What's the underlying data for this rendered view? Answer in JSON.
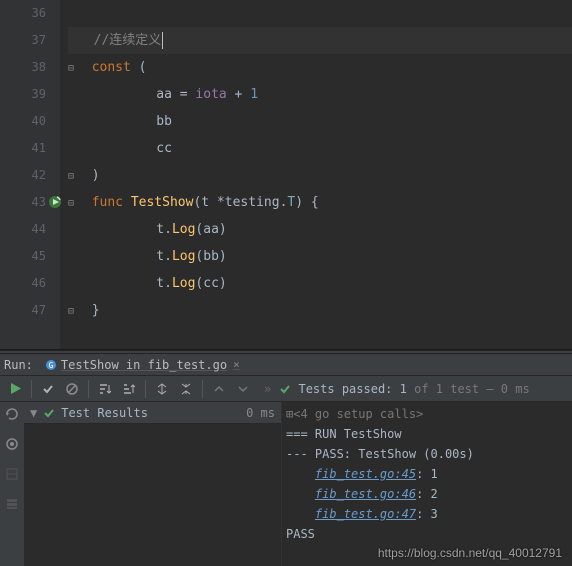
{
  "editor": {
    "lines": [
      {
        "num": 36,
        "tokens": []
      },
      {
        "num": 37,
        "active": true,
        "tokens": [
          {
            "c": "k-comment",
            "t": "//连续定义"
          }
        ],
        "caret": true,
        "indent": 1
      },
      {
        "num": 38,
        "fold": "open",
        "tokens": [
          {
            "c": "k-keyword",
            "t": "const"
          },
          {
            "c": "k-ident",
            "t": " ("
          }
        ],
        "indent": 1
      },
      {
        "num": 39,
        "tokens": [
          {
            "c": "k-ident",
            "t": "aa "
          },
          {
            "c": "k-op",
            "t": "= "
          },
          {
            "c": "k-builtin",
            "t": "iota"
          },
          {
            "c": "k-ident",
            "t": " + "
          },
          {
            "c": "k-num",
            "t": "1"
          }
        ],
        "indent": 3
      },
      {
        "num": 40,
        "tokens": [
          {
            "c": "k-ident",
            "t": "bb"
          }
        ],
        "indent": 3
      },
      {
        "num": 41,
        "tokens": [
          {
            "c": "k-ident",
            "t": "cc"
          }
        ],
        "indent": 3
      },
      {
        "num": 42,
        "fold": "close",
        "tokens": [
          {
            "c": "k-ident",
            "t": ")"
          }
        ],
        "indent": 1
      },
      {
        "num": 43,
        "fold": "open",
        "gutterIcon": true,
        "tokens": [
          {
            "c": "k-keyword",
            "t": "func"
          },
          {
            "c": "k-ident",
            "t": " "
          },
          {
            "c": "k-func",
            "t": "TestShow"
          },
          {
            "c": "k-ident",
            "t": "(t *"
          },
          {
            "c": "k-ident",
            "t": "testing"
          },
          {
            "c": "k-ident",
            "t": "."
          },
          {
            "c": "k-type",
            "t": "T"
          },
          {
            "c": "k-ident",
            "t": ") {"
          }
        ],
        "indent": 1
      },
      {
        "num": 44,
        "tokens": [
          {
            "c": "k-ident",
            "t": "t."
          },
          {
            "c": "k-func",
            "t": "Log"
          },
          {
            "c": "k-ident",
            "t": "(aa)"
          }
        ],
        "indent": 3
      },
      {
        "num": 45,
        "tokens": [
          {
            "c": "k-ident",
            "t": "t."
          },
          {
            "c": "k-func",
            "t": "Log"
          },
          {
            "c": "k-ident",
            "t": "(bb)"
          }
        ],
        "indent": 3
      },
      {
        "num": 46,
        "tokens": [
          {
            "c": "k-ident",
            "t": "t."
          },
          {
            "c": "k-func",
            "t": "Log"
          },
          {
            "c": "k-ident",
            "t": "(cc)"
          }
        ],
        "indent": 3
      },
      {
        "num": 47,
        "fold": "close",
        "tokens": [
          {
            "c": "k-ident",
            "t": "}"
          }
        ],
        "indent": 1
      }
    ]
  },
  "run": {
    "label": "Run:",
    "tab": "TestShow in fib_test.go",
    "status_prefix": "Tests passed:",
    "status_count": "1",
    "status_suffix": "of 1 test – 0 ms",
    "results_label": "Test Results",
    "results_time": "0 ms",
    "setup_calls": "<4 go setup calls>",
    "out": [
      "=== RUN   TestShow",
      "--- PASS: TestShow (0.00s)"
    ],
    "outputs": [
      {
        "file": "fib_test.go:45",
        "val": ": 1"
      },
      {
        "file": "fib_test.go:46",
        "val": ": 2"
      },
      {
        "file": "fib_test.go:47",
        "val": ": 3"
      }
    ],
    "final": "PASS"
  },
  "watermark": "https://blog.csdn.net/qq_40012791"
}
